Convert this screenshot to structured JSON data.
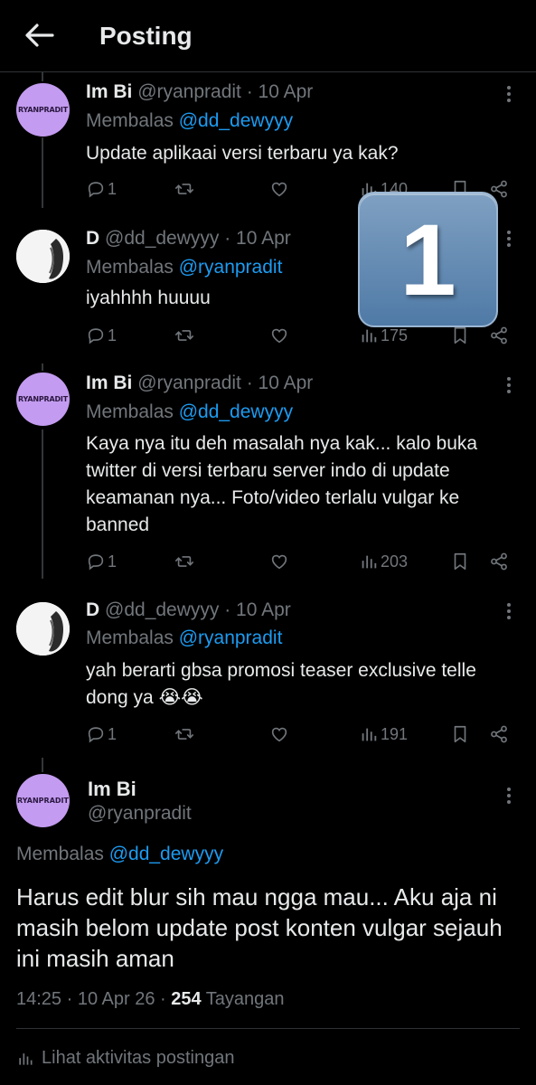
{
  "header": {
    "title": "Posting"
  },
  "tweets": [
    {
      "name": "Im Bi",
      "meta": "@ryanpradit · 10 Apr",
      "reply_prefix": "Membalas ",
      "reply_mention": "@dd_dewyyy",
      "text": "Update aplikaai versi terbaru ya kak?",
      "replies": "1",
      "views": "140",
      "avatar_label": "RYANPRADIT"
    },
    {
      "name": "D",
      "meta": "@dd_dewyyy · 10 Apr",
      "reply_prefix": "Membalas ",
      "reply_mention": "@ryanpradit",
      "text": "iyahhhh huuuu",
      "replies": "1",
      "views": "175"
    },
    {
      "name": "Im Bi",
      "meta": "@ryanpradit · 10 Apr",
      "reply_prefix": "Membalas ",
      "reply_mention": "@dd_dewyyy",
      "text": "Kaya nya itu deh masalah nya kak... kalo buka twitter di versi terbaru server indo di update keamanan nya... Foto/video terlalu vulgar ke banned",
      "replies": "1",
      "views": "203",
      "avatar_label": "RYANPRADIT"
    },
    {
      "name": "D",
      "meta": "@dd_dewyyy · 10 Apr",
      "reply_prefix": "Membalas ",
      "reply_mention": "@ryanpradit",
      "text": "yah berarti gbsa promosi teaser exclusive telle dong ya 😭😭",
      "replies": "1",
      "views": "191"
    }
  ],
  "focused": {
    "name": "Im Bi",
    "handle": "@ryanpradit",
    "avatar_label": "RYANPRADIT",
    "reply_prefix": "Membalas ",
    "reply_mention": "@dd_dewyyy",
    "text": "Harus edit blur sih mau ngga mau... Aku aja ni masih belom update post konten vulgar sejauh ini masih aman",
    "time": "14:25 · 10 Apr 26 · ",
    "views": "254",
    "views_label": " Tayangan",
    "activity": "Lihat aktivitas postingan"
  },
  "overlay_badge": "1",
  "colors": {
    "background": "#000000",
    "text": "#e7e9ea",
    "muted": "#71767b",
    "link": "#1d9bf0",
    "avatar_purple": "#c39bf0"
  },
  "icons": [
    "back-arrow-icon",
    "more-icon",
    "reply-icon",
    "retweet-icon",
    "like-icon",
    "views-icon",
    "bookmark-icon",
    "share-icon"
  ]
}
